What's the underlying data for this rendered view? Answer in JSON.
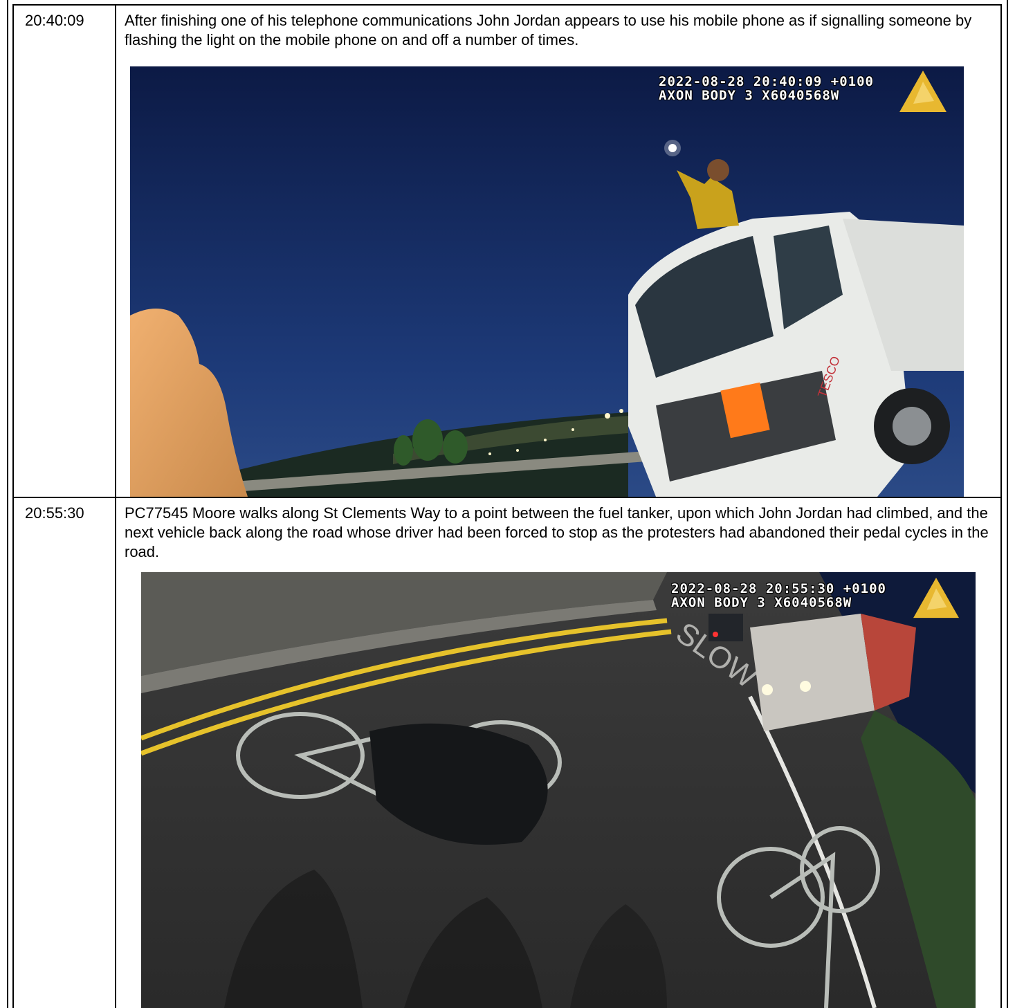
{
  "rows": [
    {
      "time": "20:40:09",
      "description": "After finishing one of his telephone communications John Jordan appears to use his mobile phone as if signalling someone by flashing the light on the mobile phone on and off a number of times.",
      "photo": {
        "stamp_line1": "2022-08-28 20:40:09 +0100",
        "stamp_line2": "AXON BODY 3 X6040568W",
        "truck_brand": "TESCO"
      }
    },
    {
      "time": "20:55:30",
      "description": "PC77545 Moore walks along St Clements Way to a point between the fuel tanker, upon which John Jordan had climbed, and the next vehicle back along the road whose driver had been forced to stop as the protesters had abandoned their pedal cycles in the road.",
      "photo": {
        "stamp_line1": "2022-08-28 20:55:30 +0100",
        "stamp_line2": "AXON BODY 3 X6040568W",
        "road_marking": "SLOW"
      }
    }
  ]
}
